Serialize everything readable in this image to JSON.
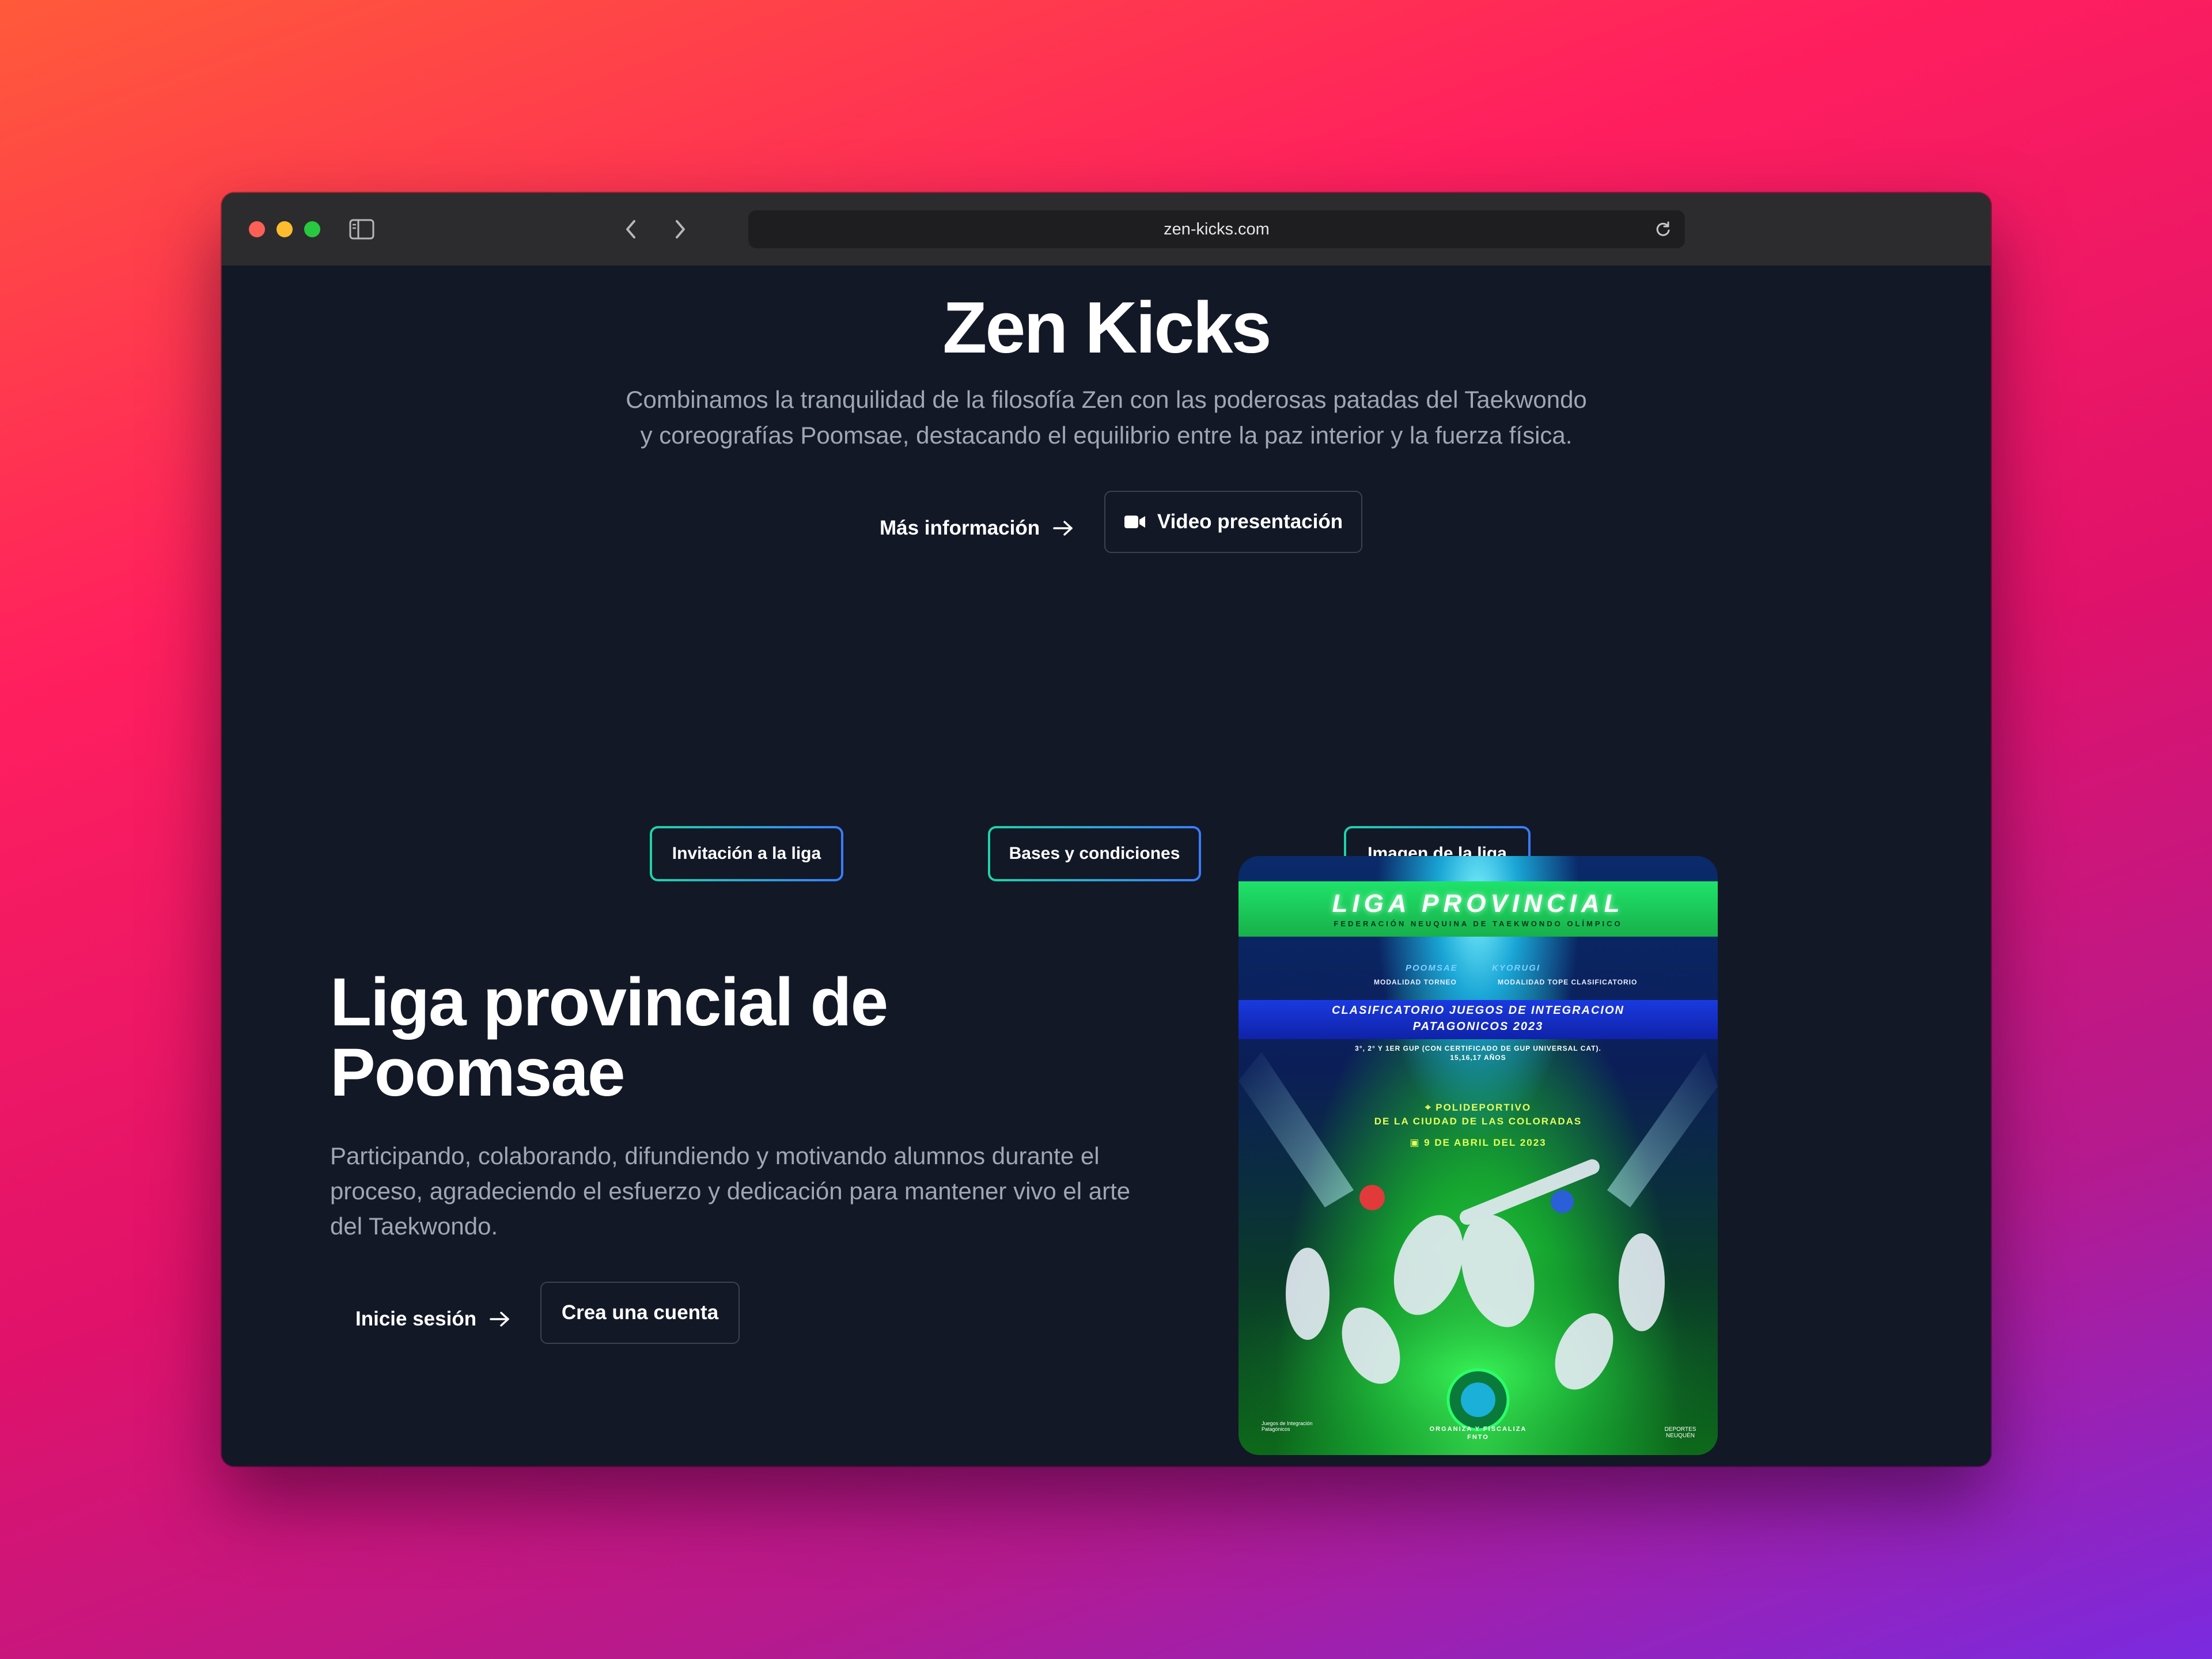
{
  "browser": {
    "url": "zen-kicks.com"
  },
  "hero": {
    "title": "Zen Kicks",
    "description_line1": "Combinamos la tranquilidad de la filosofía Zen con las poderosas patadas del Taekwondo",
    "description_line2": "y coreografías Poomsae, destacando el equilibrio entre la paz interior y la fuerza física.",
    "more_info_label": "Más información",
    "video_label": "Video presentación"
  },
  "league_links": [
    {
      "label": "Invitación a la liga"
    },
    {
      "label": "Bases y condiciones"
    },
    {
      "label": "Imagen de la liga"
    }
  ],
  "section": {
    "title_line1": "Liga provincial de",
    "title_line2": "Poomsae",
    "description": "Participando, colaborando, difundiendo y motivando alumnos durante el proceso, agradeciendo el esfuerzo y dedicación para mantener vivo el arte del Taekwondo.",
    "login_label": "Inicie sesión",
    "signup_label": "Crea una cuenta"
  },
  "poster": {
    "title": "LIGA PROVINCIAL",
    "federation": "FEDERACIÓN NEUQUINA DE TAEKWONDO OLÍMPICO",
    "mod_left": "POOMSAE",
    "mod_right": "KYORUGI",
    "mod_left_sub": "MODALIDAD TORNEO",
    "mod_right_sub": "MODALIDAD TOPE CLASIFICATORIO",
    "clasif_line1": "CLASIFICATORIO JUEGOS DE INTEGRACION",
    "clasif_line2": "PATAGONICOS 2023",
    "small_line1": "3°, 2° Y 1ER GUP (CON CERTIFICADO DE GUP UNIVERSAL CAT).",
    "small_line2": "15,16,17 AÑOS",
    "venue_line1": "POLIDEPORTIVO",
    "venue_line2": "DE LA CIUDAD DE LAS COLORADAS",
    "date": "9 DE ABRIL DEL 2023",
    "org_line1": "ORGANIZA Y FISCALIZA",
    "org_line2": "FNTO",
    "logo_left": "Juegos de Integración Patagónicos",
    "logo_right": "DEPORTES NEUQUÉN"
  },
  "colors": {
    "page_bg": "#121826",
    "accent_gradient_start": "#1fd3a8",
    "accent_gradient_end": "#3a7bff"
  }
}
